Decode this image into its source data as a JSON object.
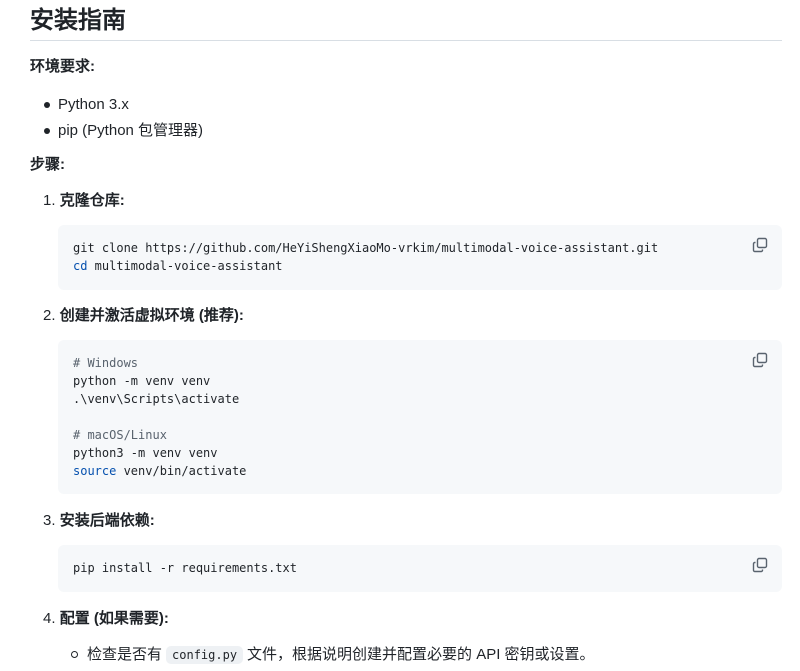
{
  "heading": "安装指南",
  "env_label": "环境要求:",
  "requirements": [
    "Python 3.x",
    "pip (Python 包管理器)"
  ],
  "steps_label": "步骤:",
  "steps": [
    {
      "num": "1.",
      "title": "克隆仓库:",
      "code": [
        [
          {
            "t": "git clone https://github.com/HeYiShengXiaoMo-vrkim/multimodal-voice-assistant.git",
            "c": ""
          }
        ],
        [
          {
            "t": "cd",
            "c": "kw"
          },
          {
            "t": " multimodal-voice-assistant",
            "c": ""
          }
        ]
      ]
    },
    {
      "num": "2.",
      "title": "创建并激活虚拟环境 (推荐):",
      "code": [
        [
          {
            "t": "# Windows",
            "c": "cmt"
          }
        ],
        [
          {
            "t": "python -m venv venv",
            "c": ""
          }
        ],
        [
          {
            "t": ".\\venv\\Scripts\\activate",
            "c": ""
          }
        ],
        [
          {
            "t": "",
            "c": ""
          }
        ],
        [
          {
            "t": "# macOS/Linux",
            "c": "cmt"
          }
        ],
        [
          {
            "t": "python3 -m venv venv",
            "c": ""
          }
        ],
        [
          {
            "t": "source",
            "c": "kw"
          },
          {
            "t": " venv/bin/activate",
            "c": ""
          }
        ]
      ]
    },
    {
      "num": "3.",
      "title": "安装后端依赖:",
      "code": [
        [
          {
            "t": "pip install -r requirements.txt",
            "c": ""
          }
        ]
      ]
    },
    {
      "num": "4.",
      "title": "配置 (如果需要):",
      "code": []
    }
  ],
  "substep": {
    "before": "检查是否有",
    "code": "config.py",
    "after": "文件，根据说明创建并配置必要的 API 密钥或设置。"
  },
  "icons": {
    "copy": "copy-icon"
  },
  "colors": {
    "code_bg": "#f6f8fa",
    "keyword": "#0550ae",
    "comment": "#59636e",
    "text": "#1f2328"
  }
}
